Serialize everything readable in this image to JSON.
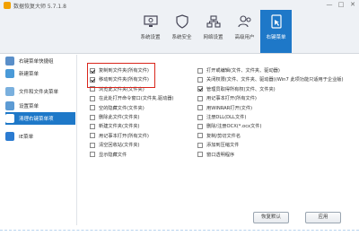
{
  "window": {
    "title": "数据恢复大师 5.7.1.8",
    "controls": [
      "—",
      "□",
      "✕"
    ]
  },
  "toolbar": [
    {
      "label": "系统设置",
      "icon": "monitor-gear-icon"
    },
    {
      "label": "系统安全",
      "icon": "shield-icon"
    },
    {
      "label": "网络设置",
      "icon": "network-icon"
    },
    {
      "label": "高级用户",
      "icon": "users-icon"
    },
    {
      "label": "右键菜单",
      "icon": "right-click-menu-icon",
      "active": true
    }
  ],
  "sidebar": {
    "items": [
      {
        "label": "右键菜单快捷组",
        "icon": "document-list-icon"
      },
      {
        "label": "新建菜单",
        "icon": "document-new-icon"
      },
      {
        "label": "文件和文件夹菜单",
        "icon": "folder-menu-icon"
      },
      {
        "label": "设置菜单",
        "icon": "gear-menu-icon"
      },
      {
        "label": "清理右键菜单项",
        "icon": "clean-menu-icon",
        "active": true
      },
      {
        "label": "IE菜单",
        "icon": "ie-icon"
      }
    ]
  },
  "options": {
    "left": [
      {
        "label": "复制到文件夹(所有文件)",
        "checked": true
      },
      {
        "label": "移动到文件夹(所有文件)",
        "checked": true
      },
      {
        "label": "浏览此文件夹(文件夹)",
        "checked": false
      },
      {
        "label": "在此处打开命令窗口(文件夹,驱动器)",
        "checked": false
      },
      {
        "label": "空的隐藏文件(文件夹)",
        "checked": false
      },
      {
        "label": "删除此文件(文件夹)",
        "checked": false
      },
      {
        "label": "新建文件夹(文件夹)",
        "checked": false
      },
      {
        "label": "用记事本打开(所有文件)",
        "checked": false
      },
      {
        "label": "清空回收站(文件夹)",
        "checked": false
      },
      {
        "label": "显示隐藏文件",
        "checked": false
      }
    ],
    "right": [
      {
        "label": "打开或编辑(文件、文件夹、驱动器)",
        "checked": false
      },
      {
        "label": "关闭权限(文件、文件夹、驱动器)(Win7 此项功能只适用于企业版)",
        "checked": false
      },
      {
        "label": "管理员取得所有权(文件、文件夹)",
        "checked": true
      },
      {
        "label": "用记事本打开(所有文件)",
        "checked": false
      },
      {
        "label": "用WINRAR打开(文件)",
        "checked": false
      },
      {
        "label": "注册DLL(DLL文件)",
        "checked": false
      },
      {
        "label": "删除/注册OCX(*.ocx文件)",
        "checked": false
      },
      {
        "label": "复制/剪切文件名",
        "checked": false
      },
      {
        "label": "添加到压缩文件",
        "checked": false
      },
      {
        "label": "窗口透明程序",
        "checked": false
      }
    ]
  },
  "buttons": {
    "restore": "恢复默认",
    "apply": "应用"
  },
  "colors": {
    "accent": "#1e78c8",
    "highlight_border": "#d9261c"
  }
}
